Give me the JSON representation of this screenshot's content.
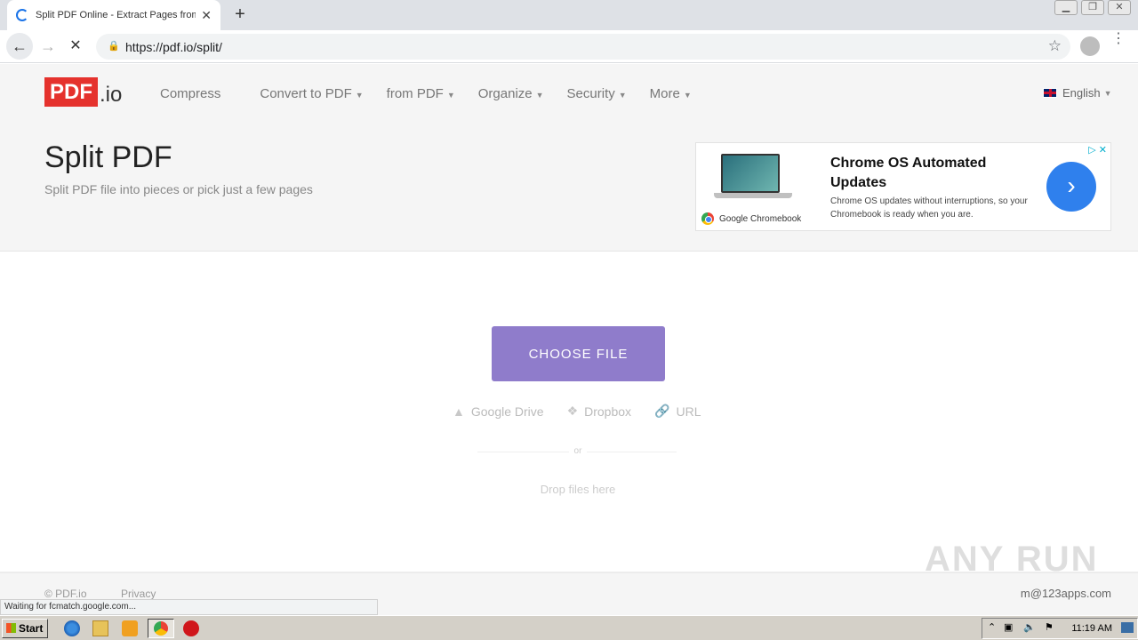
{
  "browser": {
    "tab_title": "Split PDF Online - Extract Pages from",
    "tab_close": "✕",
    "new_tab": "+",
    "url": "https://pdf.io/split/",
    "status_text": "Waiting for fcmatch.google.com..."
  },
  "site": {
    "logo_pdf": "PDF",
    "logo_io": ".io",
    "nav": [
      {
        "label": "Compress"
      },
      {
        "label": "Convert to PDF"
      },
      {
        "label": "from PDF"
      },
      {
        "label": "Organize"
      },
      {
        "label": "Security"
      },
      {
        "label": "More"
      }
    ],
    "language": "English",
    "page_title": "Split PDF",
    "page_subtitle": "Split PDF file into pieces or pick just a few pages"
  },
  "ad": {
    "headline": "Chrome OS Automated Updates",
    "description": "Chrome OS updates without interruptions, so your Chromebook is ready when you are.",
    "brand": "Google Chromebook"
  },
  "upload": {
    "choose_label": "CHOOSE FILE",
    "sources": [
      "Google Drive",
      "Dropbox",
      "URL"
    ],
    "or_text": "or",
    "drop_text": "Drop files here"
  },
  "footer": {
    "copyright": "© PDF.io",
    "privacy": "Privacy",
    "email": "m@123apps.com",
    "watermark": "ANY RUN"
  },
  "taskbar": {
    "start_label": "Start",
    "time": "11:19 AM"
  },
  "colors": {
    "brand_red": "#e5322d",
    "choose_button": "#8f7ccb",
    "ad_blue": "#2f80ed"
  }
}
